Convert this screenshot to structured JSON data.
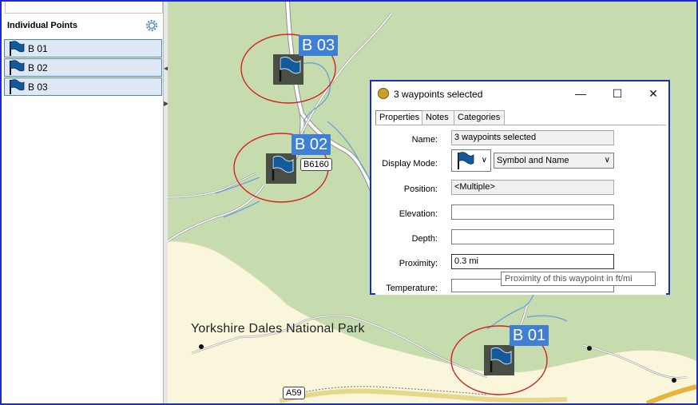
{
  "panel": {
    "title": "Individual Points",
    "points": [
      "B 01",
      "B 02",
      "B 03"
    ]
  },
  "map": {
    "waypoints": [
      {
        "label": "B 03"
      },
      {
        "label": "B 02"
      },
      {
        "label": "B 01"
      }
    ],
    "road_labels": [
      "B6160",
      "A59"
    ],
    "park_label": "Yorkshire Dales National Park"
  },
  "dialog": {
    "title": "3 waypoints selected",
    "tabs": [
      "Properties",
      "Notes",
      "Categories"
    ],
    "fields": {
      "name_label": "Name:",
      "name_value": "3 waypoints selected",
      "display_mode_label": "Display Mode:",
      "display_mode_value": "Symbol and Name",
      "position_label": "Position:",
      "position_value": "<Multiple>",
      "elevation_label": "Elevation:",
      "elevation_value": "",
      "depth_label": "Depth:",
      "depth_value": "",
      "proximity_label": "Proximity:",
      "proximity_value": "0.3 mi",
      "temperature_label": "Temperature:",
      "temperature_value": ""
    },
    "tooltip": "Proximity of this waypoint in ft/mi"
  },
  "colors": {
    "frame": "#1b2bd0",
    "map_land": "#c7dcae",
    "waypoint_label": "#3f7fd4",
    "selection_circle": "#d42020",
    "flag": "#135a9c"
  }
}
